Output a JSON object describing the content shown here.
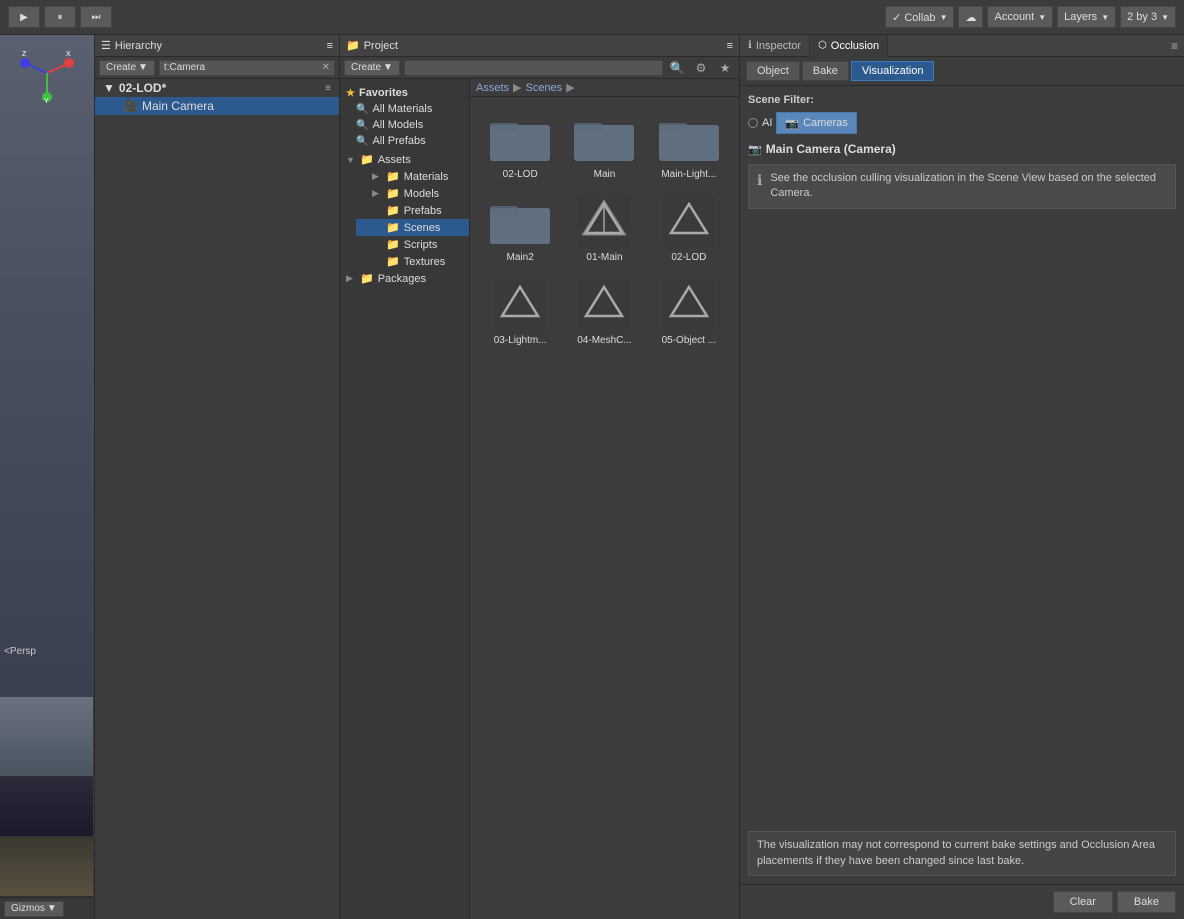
{
  "toolbar": {
    "play_label": "▶",
    "pause_label": "⏸",
    "step_label": "⏭",
    "collab_label": "✓ Collab",
    "collab_arrow": "▼",
    "cloud_label": "☁",
    "account_label": "Account",
    "account_arrow": "▼",
    "layers_label": "Layers",
    "layers_arrow": "▼",
    "layout_label": "2 by 3",
    "layout_arrow": "▼"
  },
  "hierarchy": {
    "title": "Hierarchy",
    "scene_name": "02-LOD*",
    "menu_label": "☰",
    "search_value": "t:Camera",
    "items": [
      {
        "label": "Main Camera",
        "type": "camera"
      }
    ]
  },
  "project": {
    "title": "Project",
    "create_label": "Create",
    "search_placeholder": "",
    "breadcrumb": {
      "assets": "Assets",
      "separator": "▶",
      "scenes": "Scenes"
    },
    "favorites": {
      "label": "Favorites",
      "items": [
        {
          "label": "All Materials"
        },
        {
          "label": "All Models"
        },
        {
          "label": "All Prefabs"
        }
      ]
    },
    "assets_tree": {
      "label": "Assets",
      "children": [
        {
          "label": "Materials",
          "expanded": false
        },
        {
          "label": "Models",
          "expanded": false
        },
        {
          "label": "Prefabs",
          "expanded": false
        },
        {
          "label": "Scenes",
          "expanded": false,
          "selected": true
        },
        {
          "label": "Scripts",
          "expanded": false
        },
        {
          "label": "Textures",
          "expanded": false
        }
      ]
    },
    "packages_tree": {
      "label": "Packages",
      "expanded": false
    },
    "scenes_folder": {
      "folders": [
        {
          "label": "02-LOD"
        },
        {
          "label": "Main"
        },
        {
          "label": "Main-Light..."
        },
        {
          "label": "Main2"
        }
      ],
      "unity_files": [
        {
          "label": "01-Main"
        },
        {
          "label": "02-LOD"
        },
        {
          "label": "03-Lightm..."
        },
        {
          "label": "04-MeshC..."
        },
        {
          "label": "05-Object ..."
        }
      ]
    }
  },
  "inspector": {
    "tab_label": "Inspector",
    "tab_icon": "ℹ",
    "occlusion_tab_label": "Occlusion",
    "occlusion_tab_icon": "⬡",
    "menu_label": "≡",
    "subtabs": [
      {
        "label": "Object",
        "active": false
      },
      {
        "label": "Bake",
        "active": false
      },
      {
        "label": "Visualization",
        "active": true
      }
    ],
    "scene_filter_label": "Scene Filter:",
    "filter_all_label": "AI",
    "filter_cameras_label": "Cameras",
    "camera_header": "Main Camera (Camera)",
    "info_text": "See the occlusion culling visualization in the Scene View based on the selected Camera.",
    "warning_text": "The visualization may not correspond to current bake settings and Occlusion Area placements if they have been changed since last bake.",
    "clear_btn": "Clear",
    "bake_btn": "Bake"
  },
  "colors": {
    "active_tab_bg": "#3c3c3c",
    "inactive_tab_bg": "#424242",
    "selected_bg": "#2d5a8e",
    "panel_bg": "#3c3c3c",
    "header_bg": "#424242",
    "accent_blue": "#5a88bb"
  }
}
